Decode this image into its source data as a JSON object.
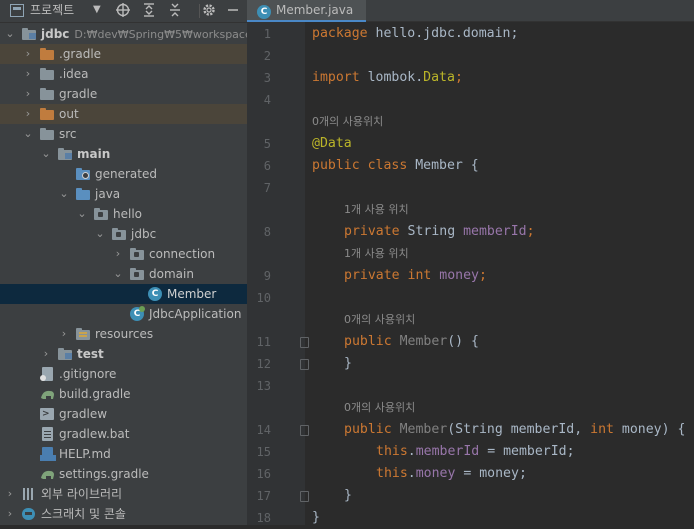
{
  "project_panel": {
    "title": "프로젝트",
    "tree": [
      {
        "label": "jdbc",
        "path": "D:₩dev₩Spring₩5₩workspace₩",
        "bold": true
      },
      {
        "label": ".gradle"
      },
      {
        "label": ".idea"
      },
      {
        "label": "gradle"
      },
      {
        "label": "out"
      },
      {
        "label": "src"
      },
      {
        "label": "main",
        "bold": true
      },
      {
        "label": "generated"
      },
      {
        "label": "java"
      },
      {
        "label": "hello"
      },
      {
        "label": "jdbc"
      },
      {
        "label": "connection"
      },
      {
        "label": "domain"
      },
      {
        "label": "Member"
      },
      {
        "label": "JdbcApplication"
      },
      {
        "label": "resources"
      },
      {
        "label": "test",
        "bold": true
      },
      {
        "label": ".gitignore"
      },
      {
        "label": "build.gradle"
      },
      {
        "label": "gradlew"
      },
      {
        "label": "gradlew.bat"
      },
      {
        "label": "HELP.md"
      },
      {
        "label": "settings.gradle"
      },
      {
        "label": "외부 라이브러리"
      },
      {
        "label": "스크래치 및 콘솔"
      }
    ]
  },
  "editor": {
    "tab_label": "Member.java",
    "line_numbers": [
      "1",
      "2",
      "3",
      "4",
      "5",
      "6",
      "7",
      "8",
      "9",
      "10",
      "11",
      "12",
      "13",
      "14",
      "15",
      "16",
      "17",
      "18"
    ],
    "code": {
      "l1_kw": "package",
      "l1_rest": " hello.jdbc.domain;",
      "l3_kw": "import",
      "l3_pkg": " lombok.",
      "l3_cls": "Data",
      "l3_end": ";",
      "l5_ann": "@Data",
      "l6_kw": "public class",
      "l6_rest": " Member {",
      "l8_kw": "private",
      "l8_type": " String ",
      "l8_field": "memberId",
      "l8_end": ";",
      "l9_kw": "private int",
      "l9_field": " money",
      "l9_end": ";",
      "l11_kw": "public",
      "l11_ctor": " Member",
      "l11_rest": "() {",
      "l12": "}",
      "l14_kw": "public",
      "l14_ctor": " Member",
      "l14_p1": "(String memberId, ",
      "l14_int": "int",
      "l14_p2": " money) {",
      "l15_this": "this",
      "l15_dot": ".",
      "l15_field": "memberId",
      "l15_rest": " = memberId;",
      "l16_this": "this",
      "l16_dot": ".",
      "l16_field": "money",
      "l16_rest": " = money;",
      "l17": "}",
      "l18": "}"
    },
    "hints": {
      "h5": "0개의 사용위치",
      "h8": "1개 사용 위치",
      "h9": "1개 사용 위치",
      "h11": "0개의 사용위치",
      "h14": "0개의 사용위치"
    }
  }
}
